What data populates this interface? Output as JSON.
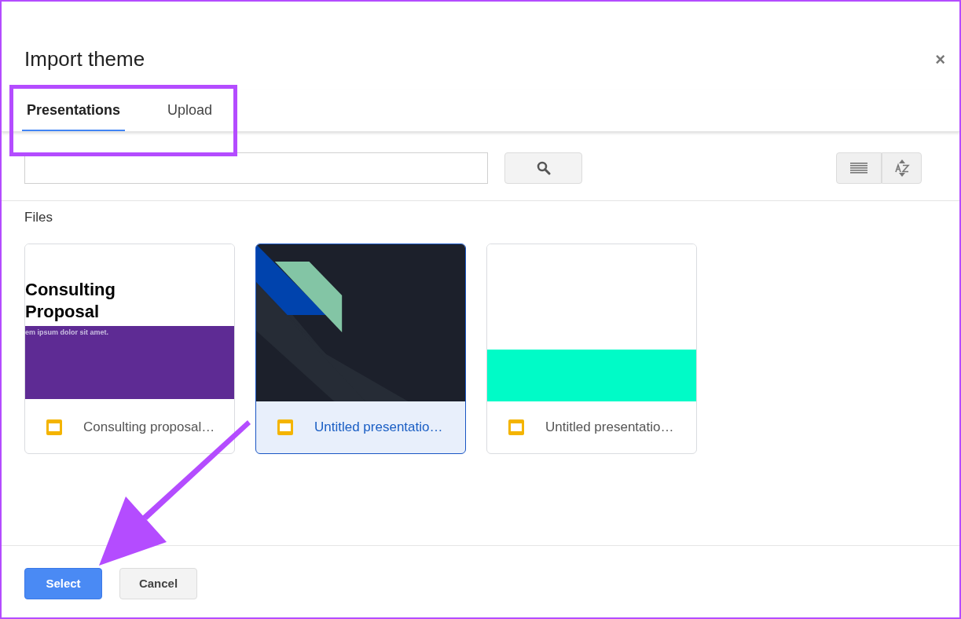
{
  "dialog": {
    "title": "Import theme",
    "close": "×"
  },
  "tabs": [
    {
      "label": "Presentations",
      "selected": true
    },
    {
      "label": "Upload",
      "selected": false
    }
  ],
  "section_label": "Files",
  "files": [
    {
      "name": "Consulting proposal…",
      "selected": false,
      "thumbnail": {
        "kind": "consulting",
        "title": "Consulting",
        "title_line2": "Proposal",
        "subtitle": "em ipsum dolor sit amet."
      }
    },
    {
      "name": "Untitled presentatio…",
      "selected": true,
      "thumbnail": {
        "kind": "dark"
      }
    },
    {
      "name": "Untitled presentatio…",
      "selected": false,
      "thumbnail": {
        "kind": "band"
      }
    }
  ],
  "buttons": [
    {
      "label": "Select",
      "kind": "primary"
    },
    {
      "label": "Cancel",
      "kind": "secondary"
    }
  ]
}
